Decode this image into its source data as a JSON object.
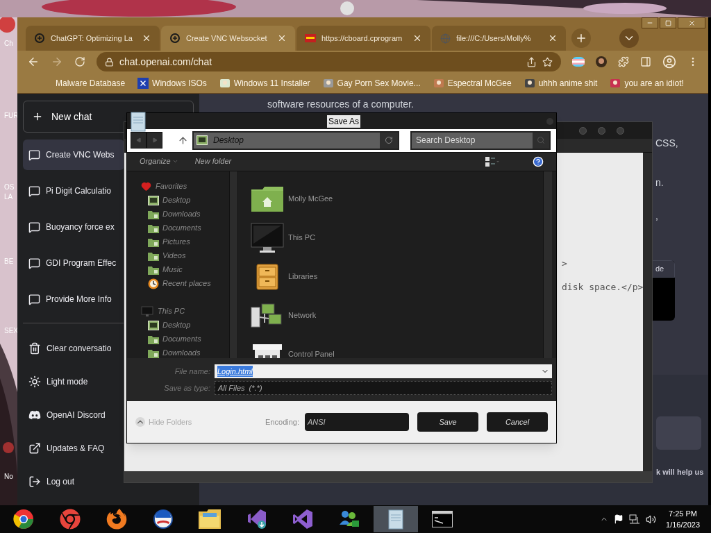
{
  "desktop": {
    "icon_labels": [
      "Ch",
      "FUR",
      "OS",
      "LA",
      "BE",
      "SEX",
      "No"
    ]
  },
  "browser": {
    "tabs": [
      {
        "title": "ChatGPT: Optimizing La",
        "kind": "openai",
        "selected": false
      },
      {
        "title": "Create VNC Websocket",
        "kind": "openai",
        "selected": true
      },
      {
        "title": "https://cboard.cprogram",
        "kind": "cboard",
        "selected": false
      },
      {
        "title": "file:///C:/Users/Molly%",
        "kind": "globe",
        "selected": false
      }
    ],
    "address": "chat.openai.com/chat",
    "bookmarks": [
      {
        "label": "Malware Database",
        "kind": "blank"
      },
      {
        "label": "Windows ISOs",
        "kind": "x"
      },
      {
        "label": "Windows 11 Installer",
        "kind": "installer"
      },
      {
        "label": "Gay Porn Sex Movie...",
        "kind": "figure"
      },
      {
        "label": "Espectral McGee",
        "kind": "face"
      },
      {
        "label": "uhhh anime shit",
        "kind": "anime"
      },
      {
        "label": "you are an idiot!",
        "kind": "flag"
      }
    ]
  },
  "chat": {
    "new_chat": "New chat",
    "conversations": [
      {
        "title": "Create VNC Webs",
        "selected": true
      },
      {
        "title": "Pi Digit Calculatio",
        "selected": false
      },
      {
        "title": "Buoyancy force ex",
        "selected": false
      },
      {
        "title": "GDI Program Effec",
        "selected": false
      },
      {
        "title": "Provide More Info",
        "selected": false
      }
    ],
    "menu": [
      {
        "label": "Clear conversatio",
        "kind": "trash"
      },
      {
        "label": "Light mode",
        "kind": "sun"
      },
      {
        "label": "OpenAI Discord",
        "kind": "discord"
      },
      {
        "label": "Updates & FAQ",
        "kind": "external"
      },
      {
        "label": "Log out",
        "kind": "logout"
      }
    ],
    "fragments": [
      "software resources of a computer.",
      "CSS,",
      "n.",
      ","
    ],
    "code_header": "de",
    "footer_fragment": "k will help us"
  },
  "notepad": {
    "lines": [
      ">",
      "disk space.</p>"
    ]
  },
  "save_dialog": {
    "title": "Save As",
    "location": "Desktop",
    "search_placeholder": "Search Desktop",
    "organize": "Organize",
    "new_folder": "New folder",
    "nav": [
      {
        "label": "Favorites",
        "kind": "favorites",
        "children": [
          {
            "label": "Desktop",
            "kind": "desktop"
          },
          {
            "label": "Downloads",
            "kind": "folder"
          },
          {
            "label": "Documents",
            "kind": "folder"
          },
          {
            "label": "Pictures",
            "kind": "folder"
          },
          {
            "label": "Videos",
            "kind": "folder"
          },
          {
            "label": "Music",
            "kind": "folder"
          },
          {
            "label": "Recent places",
            "kind": "recent"
          }
        ]
      },
      {
        "label": "This PC",
        "kind": "pc",
        "children": [
          {
            "label": "Desktop",
            "kind": "desktop"
          },
          {
            "label": "Documents",
            "kind": "folder"
          },
          {
            "label": "Downloads",
            "kind": "folder"
          }
        ]
      }
    ],
    "items": [
      {
        "label": "Molly McGee",
        "kind": "home"
      },
      {
        "label": "This PC",
        "kind": "pc"
      },
      {
        "label": "Libraries",
        "kind": "libraries"
      },
      {
        "label": "Network",
        "kind": "network"
      },
      {
        "label": "Control Panel",
        "kind": "control"
      }
    ],
    "file_name_label": "File name:",
    "file_name": "Login.html",
    "type_label": "Save as type:",
    "type": "All Files  (*.*)",
    "hide_folders": "Hide Folders",
    "encoding_label": "Encoding:",
    "encoding": "ANSI",
    "buttons": [
      "Save",
      "Cancel"
    ]
  },
  "taskbar": {
    "apps": [
      {
        "kind": "chromium",
        "active": false
      },
      {
        "kind": "chrome",
        "active": false
      },
      {
        "kind": "firefox",
        "active": false
      },
      {
        "kind": "round-logo",
        "active": false
      },
      {
        "kind": "explorer",
        "active": false
      },
      {
        "kind": "vs-preview",
        "active": false
      },
      {
        "kind": "vs",
        "active": false
      },
      {
        "kind": "messenger",
        "active": false
      },
      {
        "kind": "notepad",
        "active": true
      },
      {
        "kind": "cmd",
        "active": false
      }
    ],
    "time": "7:25 PM",
    "date": "1/16/2023"
  }
}
